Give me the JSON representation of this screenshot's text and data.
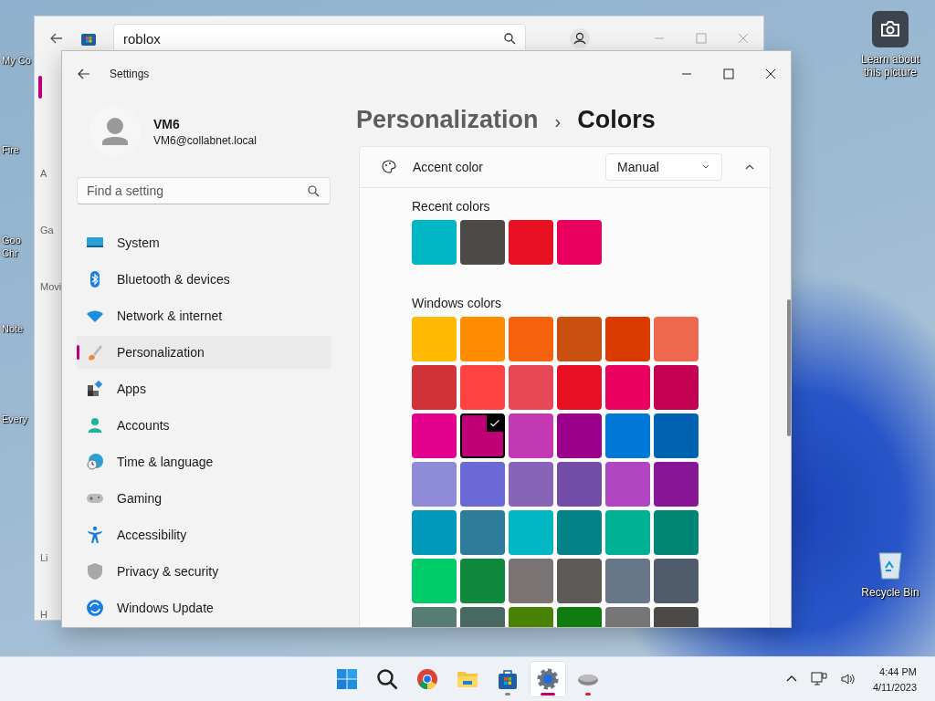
{
  "desktop_icons": [
    {
      "label": "My Co"
    },
    {
      "label": "Fire"
    },
    {
      "label": "Goo Chr"
    },
    {
      "label": "Note"
    },
    {
      "label": "Every"
    }
  ],
  "desktop_right": {
    "learn_label": "Learn about this picture",
    "recycle_label": "Recycle Bin"
  },
  "store_window": {
    "search_value": "roblox",
    "nav_fragments": [
      "A",
      "Ga",
      "Movi",
      "Li",
      "H"
    ]
  },
  "settings_window": {
    "title": "Settings"
  },
  "profile": {
    "name": "VM6",
    "email": "VM6@collabnet.local"
  },
  "search": {
    "placeholder": "Find a setting"
  },
  "nav": {
    "items": [
      {
        "label": "System",
        "selected": false
      },
      {
        "label": "Bluetooth & devices",
        "selected": false
      },
      {
        "label": "Network & internet",
        "selected": false
      },
      {
        "label": "Personalization",
        "selected": true
      },
      {
        "label": "Apps",
        "selected": false
      },
      {
        "label": "Accounts",
        "selected": false
      },
      {
        "label": "Time & language",
        "selected": false
      },
      {
        "label": "Gaming",
        "selected": false
      },
      {
        "label": "Accessibility",
        "selected": false
      },
      {
        "label": "Privacy & security",
        "selected": false
      },
      {
        "label": "Windows Update",
        "selected": false
      }
    ]
  },
  "breadcrumb": {
    "parent": "Personalization",
    "separator": "›",
    "current": "Colors"
  },
  "accent": {
    "label": "Accent color",
    "mode": "Manual",
    "expanded": true,
    "recent_label": "Recent colors",
    "recent_colors": [
      {
        "color": "#00b7c3"
      },
      {
        "color": "#4c4a48"
      },
      {
        "color": "#e81123"
      },
      {
        "color": "#ea005e"
      }
    ],
    "windows_label": "Windows colors",
    "windows_colors": [
      {
        "color": "#ffb900",
        "selected": false
      },
      {
        "color": "#ff8c00",
        "selected": false
      },
      {
        "color": "#f7630c",
        "selected": false
      },
      {
        "color": "#ca5010",
        "selected": false
      },
      {
        "color": "#da3b01",
        "selected": false
      },
      {
        "color": "#ef6950",
        "selected": false
      },
      {
        "color": "#d13438",
        "selected": false
      },
      {
        "color": "#ff4343",
        "selected": false
      },
      {
        "color": "#e74856",
        "selected": false
      },
      {
        "color": "#e81123",
        "selected": false
      },
      {
        "color": "#ea005e",
        "selected": false
      },
      {
        "color": "#c30052",
        "selected": false
      },
      {
        "color": "#e3008c",
        "selected": false
      },
      {
        "color": "#bf0077",
        "selected": true
      },
      {
        "color": "#c239b3",
        "selected": false
      },
      {
        "color": "#9a0089",
        "selected": false
      },
      {
        "color": "#0078d7",
        "selected": false
      },
      {
        "color": "#0063b1",
        "selected": false
      },
      {
        "color": "#8e8cd8",
        "selected": false
      },
      {
        "color": "#6b69d6",
        "selected": false
      },
      {
        "color": "#8764b8",
        "selected": false
      },
      {
        "color": "#744da9",
        "selected": false
      },
      {
        "color": "#b146c2",
        "selected": false
      },
      {
        "color": "#881798",
        "selected": false
      },
      {
        "color": "#0099bc",
        "selected": false
      },
      {
        "color": "#2d7d9a",
        "selected": false
      },
      {
        "color": "#00b7c3",
        "selected": false
      },
      {
        "color": "#038387",
        "selected": false
      },
      {
        "color": "#00b294",
        "selected": false
      },
      {
        "color": "#018574",
        "selected": false
      },
      {
        "color": "#00cc6a",
        "selected": false
      },
      {
        "color": "#10893e",
        "selected": false
      },
      {
        "color": "#7a7574",
        "selected": false
      },
      {
        "color": "#5d5a58",
        "selected": false
      },
      {
        "color": "#68768a",
        "selected": false
      },
      {
        "color": "#515c6b",
        "selected": false
      },
      {
        "color": "#567c73",
        "selected": false
      },
      {
        "color": "#486860",
        "selected": false
      },
      {
        "color": "#498205",
        "selected": false
      },
      {
        "color": "#107c10",
        "selected": false
      },
      {
        "color": "#767676",
        "selected": false
      },
      {
        "color": "#4c4a48",
        "selected": false
      }
    ]
  },
  "taskbar": {
    "apps": [
      {
        "running": false,
        "active": false
      },
      {
        "running": false,
        "active": false
      },
      {
        "running": false,
        "active": false
      },
      {
        "running": false,
        "active": false
      },
      {
        "running": true,
        "active": false
      },
      {
        "running": true,
        "active": true
      },
      {
        "running": true,
        "active": false
      }
    ],
    "time": "4:44 PM",
    "date": "4/11/2023"
  }
}
